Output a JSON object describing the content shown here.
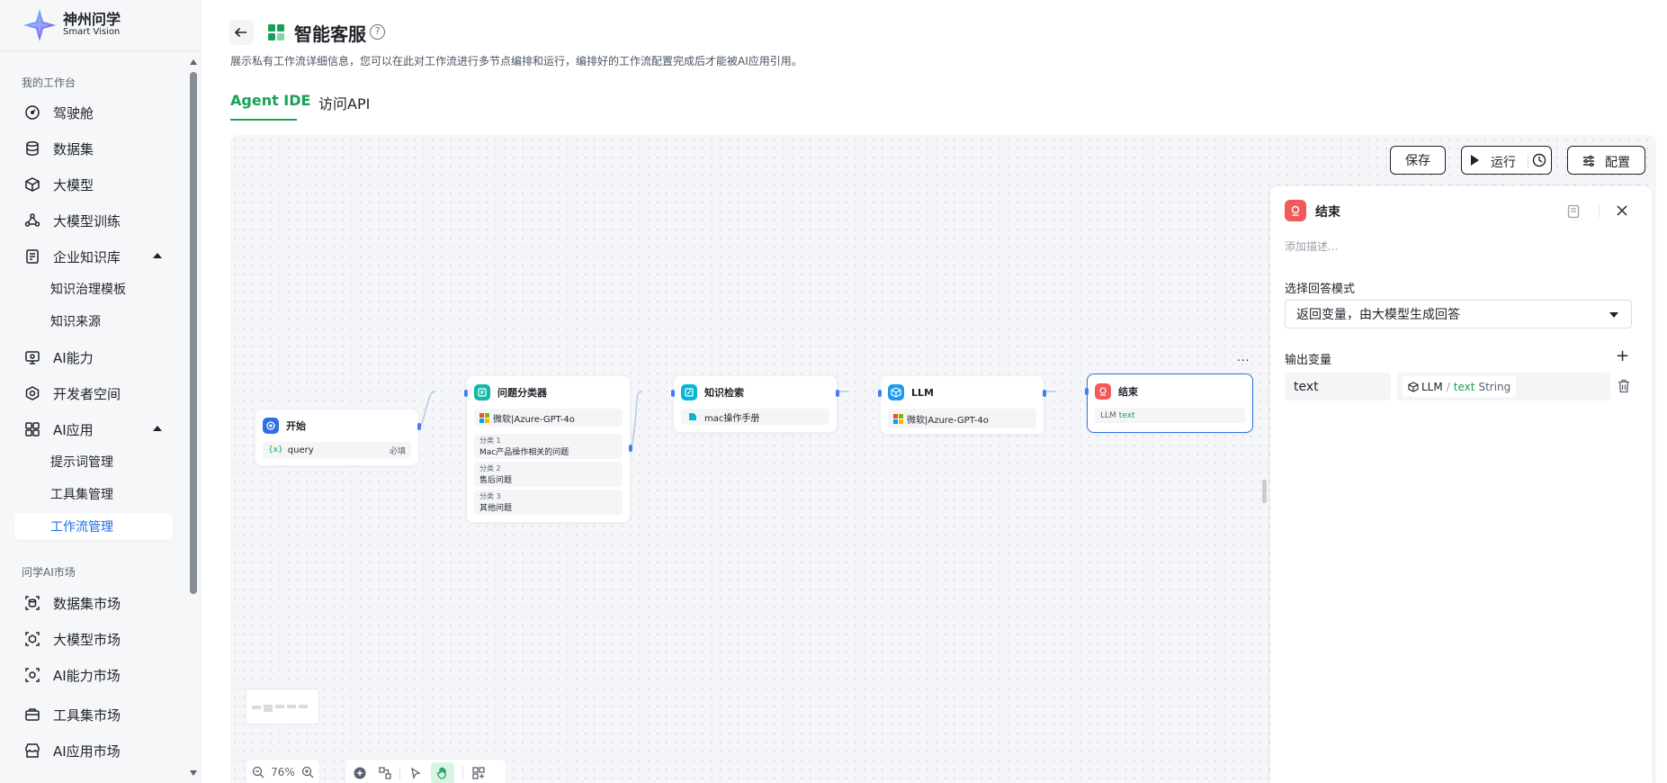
{
  "logo": {
    "cn": "神州问学",
    "en": "Smart Vision"
  },
  "sidebar": {
    "section_workspace": "我的工作台",
    "items": [
      {
        "label": "驾驶舱",
        "icon": "dashboard-icon"
      },
      {
        "label": "数据集",
        "icon": "database-icon"
      },
      {
        "label": "大模型",
        "icon": "cube-icon"
      },
      {
        "label": "大模型训练",
        "icon": "training-icon"
      },
      {
        "label": "企业知识库",
        "icon": "knowledge-base-icon"
      },
      {
        "label": "AI能力",
        "icon": "monitor-icon"
      },
      {
        "label": "开发者空间",
        "icon": "developer-icon"
      },
      {
        "label": "AI应用",
        "icon": "apps-grid-icon"
      }
    ],
    "knowledge_sub": [
      "知识治理模板",
      "知识来源"
    ],
    "ai_app_sub": [
      "提示词管理",
      "工具集管理",
      "工作流管理"
    ],
    "section_market": "问学AI市场",
    "market_items": [
      {
        "label": "数据集市场",
        "icon": "dataset-market-icon"
      },
      {
        "label": "大模型市场",
        "icon": "model-market-icon"
      },
      {
        "label": "AI能力市场",
        "icon": "ai-market-icon"
      },
      {
        "label": "工具集市场",
        "icon": "toolbox-market-icon"
      },
      {
        "label": "AI应用市场",
        "icon": "store-icon"
      }
    ]
  },
  "header": {
    "title": "智能客服",
    "description": "展示私有工作流详细信息，您可以在此对工作流进行多节点编排和运行，编排好的工作流配置完成后才能被AI应用引用。",
    "help": "?"
  },
  "tabs": [
    {
      "label": "Agent IDE"
    },
    {
      "label": "访问API"
    }
  ],
  "toolbar": {
    "save": "保存",
    "run": "运行",
    "config": "配置"
  },
  "nodes": {
    "start": {
      "title": "开始",
      "var": "query",
      "required": "必填",
      "var_prefix": "{x}"
    },
    "classifier": {
      "title": "问题分类器",
      "model": "微软|Azure-GPT-4o",
      "classes": [
        {
          "label": "分类 1",
          "text": "Mac产品操作相关的问题"
        },
        {
          "label": "分类 2",
          "text": "售后问题"
        },
        {
          "label": "分类 3",
          "text": "其他问题"
        }
      ]
    },
    "retrieval": {
      "title": "知识检索",
      "kb": "mac操作手册"
    },
    "llm": {
      "title": "LLM",
      "model": "微软|Azure-GPT-4o"
    },
    "end": {
      "title": "结束",
      "src": "LLM",
      "var": "text",
      "more": "..."
    }
  },
  "zoom": {
    "level": "76%"
  },
  "panel": {
    "title": "结束",
    "desc_placeholder": "添加描述...",
    "mode_label": "选择回答模式",
    "mode_value": "返回变量，由大模型生成回答",
    "output_label": "输出变量",
    "add": "+",
    "var_name": "text",
    "ref_node": "LLM",
    "ref_sep": "/",
    "ref_var": "text",
    "ref_type": "String"
  },
  "colors": {
    "accent": "#18a058",
    "primary": "#1f6ee8",
    "end_node": "#f25a5a",
    "edge": "#b7c6e8"
  }
}
